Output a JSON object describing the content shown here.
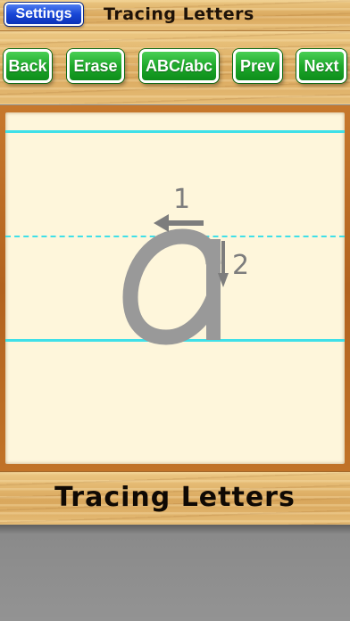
{
  "top_bar": {
    "settings_label": "Settings",
    "title": "Tracing Letters"
  },
  "nav": {
    "back_label": "Back",
    "erase_label": "Erase",
    "case_label": "ABC/abc",
    "prev_label": "Prev",
    "next_label": "Next"
  },
  "tracing": {
    "letter": "a",
    "stroke_1_label": "1",
    "stroke_2_label": "2",
    "guide_color": "#3fe0e8",
    "letter_color": "#999999",
    "arrow_color": "#7d7d7d"
  },
  "bottom_bar": {
    "title": "Tracing Letters"
  },
  "colors": {
    "wood": "#e0b46d",
    "board_frame": "#b2621e",
    "paper": "#fef6db",
    "settings_button": "#1846d6",
    "nav_button": "#1ea92b"
  },
  "icons": {
    "stroke_arrow_left": "arrow-left-icon",
    "stroke_arrow_down": "arrow-down-icon"
  }
}
